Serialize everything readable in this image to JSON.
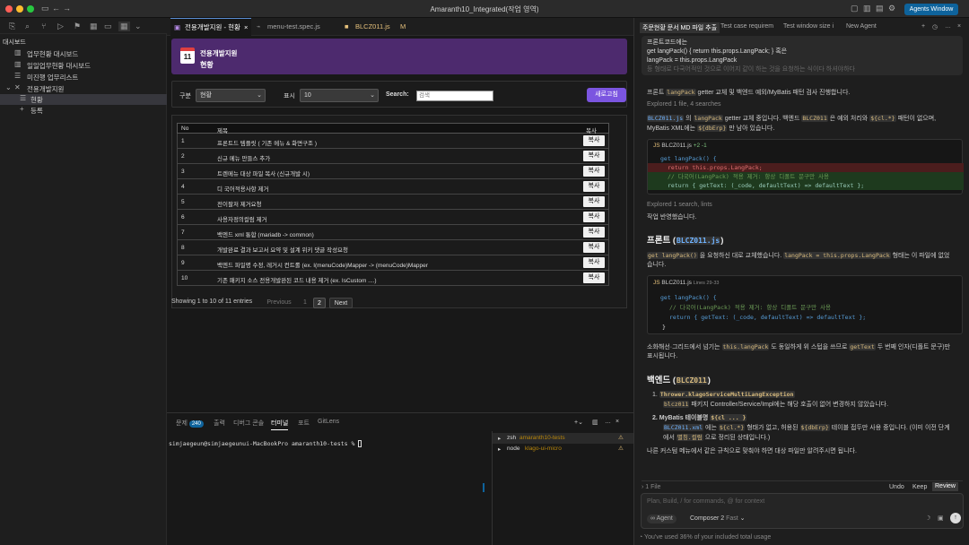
{
  "window": {
    "title": "Amaranth10_Integrated(작업 영역)",
    "agents_label": "Agents Window"
  },
  "sidebar": {
    "title": "대시보드",
    "items": [
      {
        "label": "업무현황 대시보드"
      },
      {
        "label": "일일업무현황 대시보드"
      },
      {
        "label": "미진행 업무리스트"
      },
      {
        "label": "전용개발지원"
      },
      {
        "label": "현황"
      },
      {
        "label": "등록"
      }
    ]
  },
  "tabs": [
    {
      "label": "전용개발지원 - 현황"
    },
    {
      "label": "menu-test.spec.js"
    },
    {
      "label": "BLCZ011.js",
      "badge": "M"
    }
  ],
  "page": {
    "day": "11",
    "header_title": "전용개발지원",
    "header_subtitle": "현황",
    "filters": {
      "category_label": "구분",
      "category_value": "현황",
      "display_label": "표시",
      "display_value": "10",
      "search_label": "Search:",
      "search_placeholder": "검색",
      "refresh_button": "새로고침"
    },
    "table": {
      "headers": [
        "No",
        "제목",
        "복사"
      ],
      "copy_label": "복사",
      "rows": [
        {
          "no": "1",
          "title": "프론트드 템플릿 ( 기존 메뉴 & 화면구조 )"
        },
        {
          "no": "2",
          "title": "신규 메뉴 만들스 추가"
        },
        {
          "no": "3",
          "title": "트렌메뉴 대상 파일 복사 (신규개발 시)"
        },
        {
          "no": "4",
          "title": "디 국어적용사항 제거"
        },
        {
          "no": "5",
          "title": "전이팔저 제거요청"
        },
        {
          "no": "6",
          "title": "사용자정의컬럼 제거"
        },
        {
          "no": "7",
          "title": "백엔드 xml 통합 (mariadb -> common)"
        },
        {
          "no": "8",
          "title": "개발완료 결과 보고서 요약 및 설계 위키 댓글 작성요청"
        },
        {
          "no": "9",
          "title": "백엔드 파일명 수정, 레거시 컨트롤 (ex. I(menuCode)Mapper -> (menuCode)Mapper"
        },
        {
          "no": "10",
          "title": "기존 패키지 소스 전용개발완된 코드 내용 제거 (ex. IsCustom ....)"
        }
      ],
      "footer": "Showing 1 to 10 of 11 entries",
      "pagination": {
        "prev": "Previous",
        "pages": [
          "1",
          "2"
        ],
        "next": "Next"
      }
    }
  },
  "panel": {
    "tabs": [
      {
        "label": "문제",
        "badge": "240"
      },
      {
        "label": "출력"
      },
      {
        "label": "디버그 콘솔"
      },
      {
        "label": "터미널"
      },
      {
        "label": "포트"
      },
      {
        "label": "GitLens"
      }
    ],
    "terminal_prompt": "simjaegeun@simjaegeunui-MacBookPro amaranth10-tests %",
    "terminals": [
      {
        "name": "zsh",
        "desc": "amaranth10-tests"
      },
      {
        "name": "node",
        "desc": "klago-ui-micro"
      }
    ]
  },
  "chat": {
    "tabs": [
      "주문현황 문서 MD 파일 추출",
      "Test case requirem",
      "Test window size i",
      "New Agent"
    ],
    "quote": [
      "프론트코드에는",
      "get langPack() { return this.props.LangPack; } 혹은",
      "langPack = this.props.LangPack",
      "등 형태로 다국어적인 것으로 이어지 같이 하는 것을 요청하는 식이다 하셔야하다"
    ],
    "p1_pre": "프론트",
    "p1_code": "langPack",
    "p1_post": "getter 교체 및 백엔드 예외/MyBatis 패턴 검사 진행합니다.",
    "explored1": "Explored 1 file, 4 searches",
    "p2_code1": "BLCZ011.js",
    "p2_mid1": "의",
    "p2_code2": "langPack",
    "p2_mid2": "getter 교체 중입니다. 백엔드",
    "p2_code3": "BLCZ011",
    "p2_mid3": "은 예외 처리와",
    "p2_code4": "${cl.*}",
    "p2_post": "패턴이 없으며,",
    "p3_pre": "MyBatis XML에는",
    "p3_code": "${dbErp}",
    "p3_post": "만 남아 있습니다.",
    "diff_file": "BLCZ011.js",
    "diff_stat": "+2 -1",
    "diff_lines": [
      "get langPack() {",
      "return this.props.LangPack;",
      "// 다국어(LangPack) 적용 제거: 항상 디폴트 문구만 사용",
      "return { getText: (_code, defaultText) => defaultText };"
    ],
    "explored2": "Explored 1 search, lints",
    "done": "작업 반영했습니다.",
    "h_front": "프론트 (",
    "h_front_code": "BLCZ011.js",
    "h_front_end": ")",
    "p4_code1": "get langPack()",
    "p4_mid": "을 요청하신 대로 교체했습니다.",
    "p4_code2": "langPack = this.props.LangPack",
    "p4_post": "형태는 이 파일에 없었",
    "p4_line2": "습니다.",
    "code_file": "BLCZ011.js",
    "code_lines_label": "Lines 29-33",
    "code_lines": [
      "get langPack() {",
      "// 다국어(LangPack) 적용 제거: 항상 디폴트 문구만 사용",
      "return { getText: (_code, defaultText) => defaultText };",
      "}"
    ],
    "p5_pre": "소화해선·그리드에서 넘기는",
    "p5_code1": "this.langPack",
    "p5_mid": "도 동일하게 위 스텁을 쓰므로",
    "p5_code2": "getText",
    "p5_post": "두 번째 인자(디폴트 문구)만",
    "p5_line2": "표시됩니다.",
    "h_back": "백엔드 (",
    "h_back_code": "BLCZ011",
    "h_back_end": ")",
    "li1_code": "Thrower.klagoServiceMultiLangException",
    "li1_sub_code": "blcz011",
    "li1_sub": "패키지 Controller/Service/Impl에는 해당 호출이 없어 변경하지 않았습니다.",
    "li2_title": "MyBatis 테이블명",
    "li2_code": "${cl ... }",
    "li2_sub_code1": "BLCZ011.xml",
    "li2_sub1": "에는",
    "li2_sub_code2": "${cl.*}",
    "li2_sub2": "형태가 없고, 허용된",
    "li2_sub_code3": "${dbErp}",
    "li2_sub3": "테이블 접두만 사용 중입니다. (이미 이전 단계",
    "li2_sub_line2": "에서",
    "li2_sub_code4": "별칭.컬럼",
    "li2_sub_line2b": "으로 정리된 상태입니다.)",
    "outro": "나른 커스텀 메뉴에서 같은 규칙으로 맞춰야 하면 대상 파일만 알려주시면 됩니다.",
    "files_bar": "1 File",
    "undo": "Undo",
    "keep": "Keep",
    "review": "Review",
    "input_placeholder": "Plan, Build, / for commands, @ for context",
    "agent_label": "Agent",
    "model_label": "Composer 2",
    "speed_label": "Fast",
    "usage": "You've used 36% of your included total usage"
  }
}
